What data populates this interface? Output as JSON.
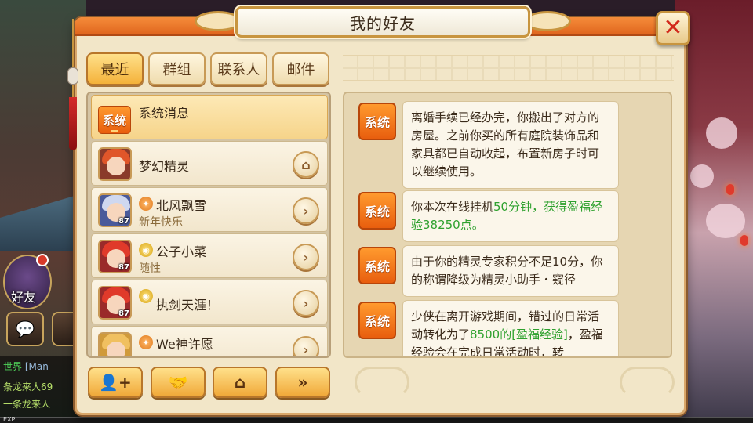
{
  "window": {
    "title": "我的好友",
    "close_symbol": "✕"
  },
  "tabs": [
    {
      "label": "最近",
      "active": true
    },
    {
      "label": "群组",
      "active": false
    },
    {
      "label": "联系人",
      "active": false
    },
    {
      "label": "邮件",
      "active": false
    }
  ],
  "friends": [
    {
      "name": "系统消息",
      "type": "system",
      "badge": "系统"
    },
    {
      "name": "梦幻精灵",
      "type": "npc",
      "action_icon": "home-icon"
    },
    {
      "name": "北风飘雪",
      "status": "新年快乐",
      "level": "87",
      "relation_icon": "flame-icon",
      "action_icon": "chevron-right-icon"
    },
    {
      "name": "公子小菜",
      "status": "随性",
      "level": "87",
      "relation_icon": "gold-coin-icon",
      "action_icon": "chevron-right-icon"
    },
    {
      "name": "执剑天涯！",
      "level": "87",
      "relation_icon": "gold-coin-icon",
      "action_icon": "chevron-right-icon"
    },
    {
      "name": "We神许愿",
      "relation_icon": "flame-icon",
      "action_icon": "chevron-right-icon"
    }
  ],
  "bottom_buttons": [
    {
      "icon": "add-friend-icon",
      "glyph": "👤+"
    },
    {
      "icon": "handshake-icon",
      "glyph": "🤝"
    },
    {
      "icon": "home-icon",
      "glyph": "⌂"
    },
    {
      "icon": "double-chevron-right-icon",
      "glyph": "»"
    }
  ],
  "messages": [
    {
      "badge": "系统",
      "parts": [
        {
          "text": "离婚手续已经办完，你搬出了对方的房屋。之前你买的所有庭院装饰品和家具都已自动收起，布置新房子时可以继续使用。",
          "hl": false
        }
      ]
    },
    {
      "badge": "系统",
      "parts": [
        {
          "text": "你本次在线挂机",
          "hl": false
        },
        {
          "text": "50分钟，获得盈福经验38250点。",
          "hl": true
        }
      ]
    },
    {
      "badge": "系统",
      "parts": [
        {
          "text": "由于你的精灵专家积分不足10分，你的称谓降级为精灵小助手・窥径",
          "hl": false
        }
      ]
    },
    {
      "badge": "系统",
      "parts": [
        {
          "text": "少侠在离开游戏期间，错过的日常活动转化为了",
          "hl": false
        },
        {
          "text": "8500的[盈福经验]",
          "hl": true
        },
        {
          "text": "，盈福经验会在完成日常活动时，转",
          "hl": false
        }
      ]
    }
  ],
  "hud": {
    "friend_label": "好友",
    "chat_world": "世界",
    "chat_world_sender": "[Man",
    "chat_line2": "条龙来人69",
    "chat_line3": "一条龙来人",
    "exp_label": "EXP"
  },
  "colors": {
    "accent_orange": "#e85e0e",
    "highlight_green": "#2ea12e",
    "panel_bg": "#f2e6c8",
    "close_red": "#d22a1c"
  }
}
